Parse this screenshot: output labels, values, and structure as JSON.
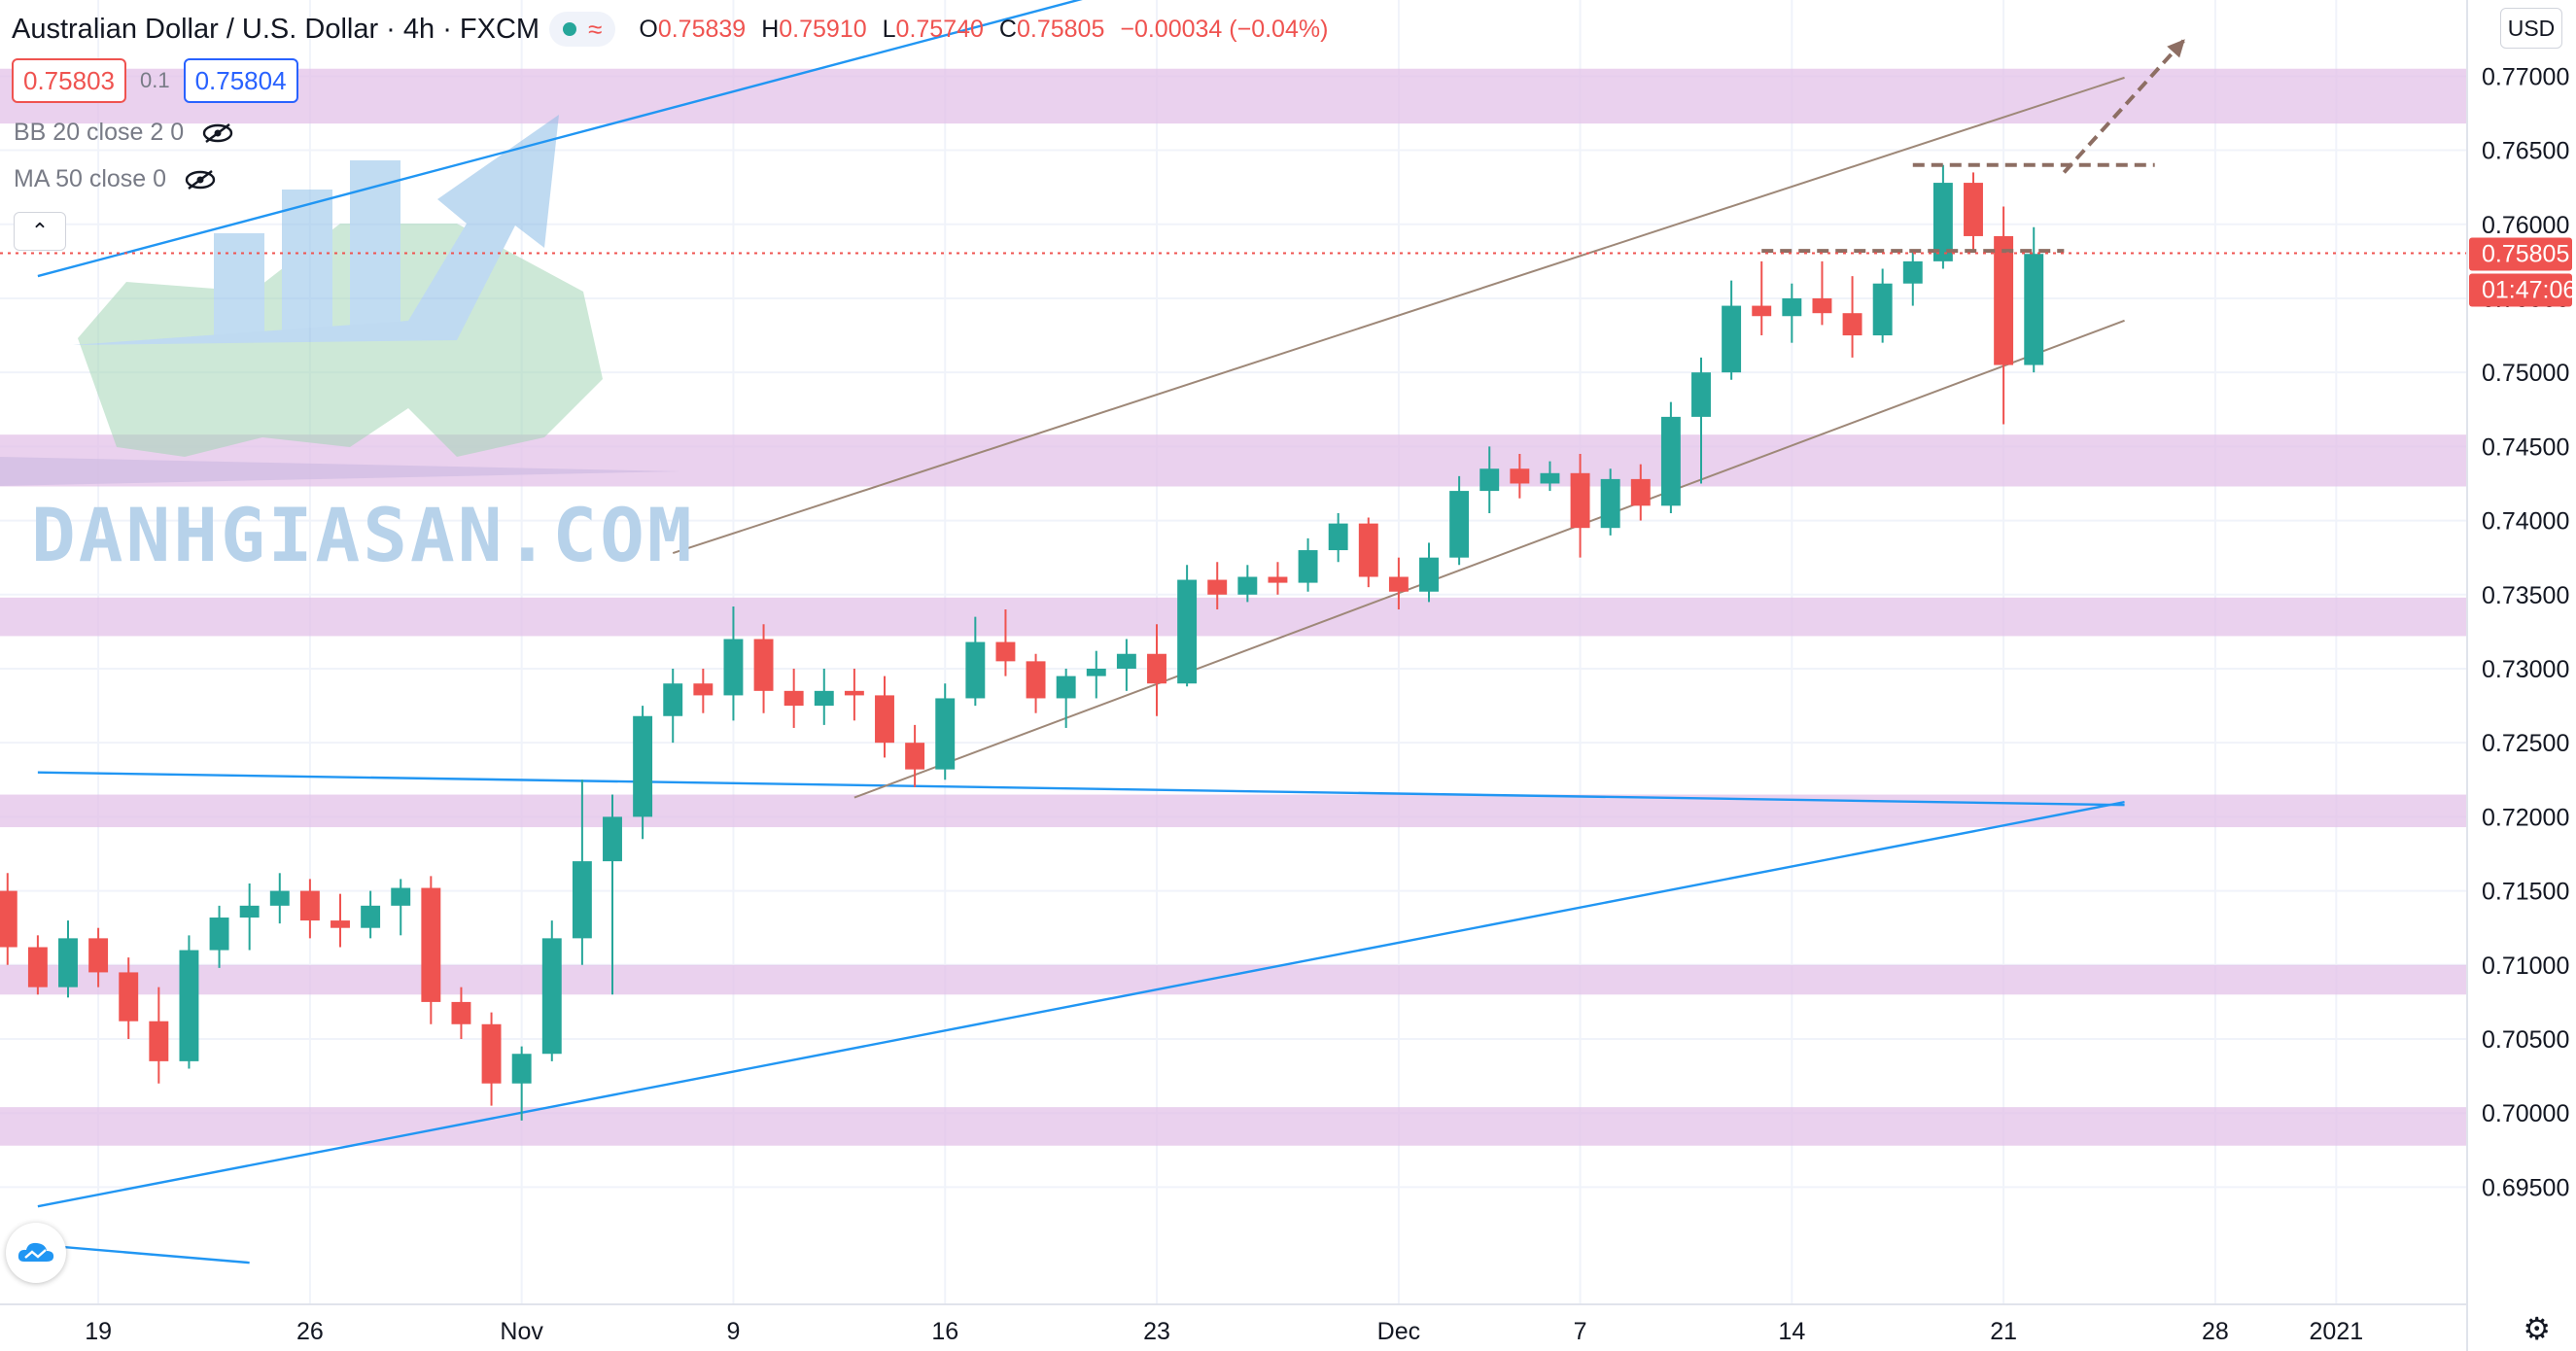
{
  "header": {
    "symbol_title": "Australian Dollar / U.S. Dollar · 4h · FXCM",
    "ohlc_o": "0.75839",
    "ohlc_h": "0.75910",
    "ohlc_l": "0.75740",
    "ohlc_c": "0.75805",
    "change": "−0.00034 (−0.04%)",
    "o_label": "O",
    "h_label": "H",
    "l_label": "L",
    "c_label": "C"
  },
  "trade": {
    "sell_price": "0.75803",
    "spread": "0.1",
    "buy_price": "0.75804"
  },
  "indicators": [
    {
      "label": "BB 20 close 2 0"
    },
    {
      "label": "MA 50 close 0"
    }
  ],
  "currency": "USD",
  "watermark": {
    "text": "DANHGIASAN.COM"
  },
  "colors": {
    "up": "#26a69a",
    "down": "#ef5350",
    "zone": "#e1bee7",
    "trend": "#2196f3",
    "channel": "#9e8878",
    "dashed": "#8d6e63"
  },
  "chart_data": {
    "type": "candlestick",
    "title": "",
    "ylim": [
      0.6905,
      0.7735
    ],
    "y_ticks": [
      "0.77000",
      "0.76500",
      "0.76000",
      "0.75500",
      "0.75000",
      "0.74500",
      "0.74000",
      "0.73500",
      "0.73000",
      "0.72500",
      "0.72000",
      "0.71500",
      "0.71000",
      "0.70500",
      "0.70000",
      "0.69500"
    ],
    "x_ticks": [
      {
        "label": "19",
        "date": "2020-10-19"
      },
      {
        "label": "26",
        "date": "2020-10-26"
      },
      {
        "label": "Nov",
        "date": "2020-11-02"
      },
      {
        "label": "9",
        "date": "2020-11-09"
      },
      {
        "label": "16",
        "date": "2020-11-16"
      },
      {
        "label": "23",
        "date": "2020-11-23"
      },
      {
        "label": "Dec",
        "date": "2020-12-01"
      },
      {
        "label": "7",
        "date": "2020-12-07"
      },
      {
        "label": "14",
        "date": "2020-12-14"
      },
      {
        "label": "21",
        "date": "2020-12-21"
      },
      {
        "label": "28",
        "date": "2020-12-28"
      },
      {
        "label": "2021",
        "date": "2021-01-01"
      }
    ],
    "last_price": "0.75805",
    "countdown": "01:47:06",
    "support_resistance_zones": [
      [
        0.7668,
        0.7705
      ],
      [
        0.7423,
        0.7458
      ],
      [
        0.7322,
        0.7348
      ],
      [
        0.7193,
        0.7215
      ],
      [
        0.708,
        0.71
      ],
      [
        0.6978,
        0.7004
      ]
    ],
    "trendlines": [
      {
        "from": [
          "2020-10-17",
          0.7565
        ],
        "to": [
          "2020-11-29",
          0.7798
        ]
      },
      {
        "from": [
          "2020-10-17",
          0.723
        ],
        "to": [
          "2020-12-25",
          0.7208
        ]
      },
      {
        "from": [
          "2020-10-17",
          0.6937
        ],
        "to": [
          "2020-12-25",
          0.721
        ]
      },
      {
        "from": [
          "2020-10-17",
          0.6911
        ],
        "to": [
          "2020-10-24",
          0.6899
        ]
      },
      {
        "from": [
          "2020-11-07",
          0.7378
        ],
        "to": [
          "2020-12-25",
          0.7699
        ]
      },
      {
        "from": [
          "2020-11-13",
          0.7213
        ],
        "to": [
          "2020-12-25",
          0.7535
        ]
      }
    ],
    "dashed_levels": [
      {
        "from": "2020-12-18",
        "to": "2020-12-26",
        "value": 0.764
      },
      {
        "from": "2020-12-13",
        "to": "2020-12-23",
        "value": 0.7582
      }
    ],
    "projection_arrow": {
      "from": [
        "2020-12-23",
        0.7635
      ],
      "to": [
        "2020-12-27",
        0.7725
      ]
    },
    "candles": [
      [
        "2020-10-16",
        0.715,
        0.7162,
        0.71,
        0.7112
      ],
      [
        "2020-10-17",
        0.7112,
        0.712,
        0.708,
        0.7085
      ],
      [
        "2020-10-18",
        0.7085,
        0.713,
        0.7078,
        0.7118
      ],
      [
        "2020-10-19",
        0.7118,
        0.7125,
        0.7085,
        0.7095
      ],
      [
        "2020-10-20",
        0.7095,
        0.7105,
        0.705,
        0.7062
      ],
      [
        "2020-10-21",
        0.7062,
        0.7085,
        0.702,
        0.7035
      ],
      [
        "2020-10-22",
        0.7035,
        0.712,
        0.703,
        0.711
      ],
      [
        "2020-10-23",
        0.711,
        0.714,
        0.7098,
        0.7132
      ],
      [
        "2020-10-24",
        0.7132,
        0.7155,
        0.711,
        0.714
      ],
      [
        "2020-10-25",
        0.714,
        0.7162,
        0.7128,
        0.715
      ],
      [
        "2020-10-26",
        0.715,
        0.7158,
        0.7118,
        0.713
      ],
      [
        "2020-10-27",
        0.713,
        0.7148,
        0.7112,
        0.7125
      ],
      [
        "2020-10-28",
        0.7125,
        0.715,
        0.7118,
        0.714
      ],
      [
        "2020-10-29",
        0.714,
        0.7158,
        0.712,
        0.7152
      ],
      [
        "2020-10-30",
        0.7152,
        0.716,
        0.706,
        0.7075
      ],
      [
        "2020-10-31",
        0.7075,
        0.7085,
        0.705,
        0.706
      ],
      [
        "2020-11-01",
        0.706,
        0.7068,
        0.7005,
        0.702
      ],
      [
        "2020-11-02",
        0.702,
        0.7045,
        0.6995,
        0.704
      ],
      [
        "2020-11-03",
        0.704,
        0.713,
        0.7035,
        0.7118
      ],
      [
        "2020-11-04",
        0.7118,
        0.7225,
        0.71,
        0.717
      ],
      [
        "2020-11-05",
        0.717,
        0.7215,
        0.708,
        0.72
      ],
      [
        "2020-11-06",
        0.72,
        0.7275,
        0.7185,
        0.7268
      ],
      [
        "2020-11-07",
        0.7268,
        0.73,
        0.725,
        0.729
      ],
      [
        "2020-11-08",
        0.729,
        0.73,
        0.727,
        0.7282
      ],
      [
        "2020-11-09",
        0.7282,
        0.7342,
        0.7265,
        0.732
      ],
      [
        "2020-11-10",
        0.732,
        0.733,
        0.727,
        0.7285
      ],
      [
        "2020-11-11",
        0.7285,
        0.73,
        0.726,
        0.7275
      ],
      [
        "2020-11-12",
        0.7275,
        0.73,
        0.7262,
        0.7285
      ],
      [
        "2020-11-13",
        0.7285,
        0.73,
        0.7265,
        0.7282
      ],
      [
        "2020-11-14",
        0.7282,
        0.7295,
        0.724,
        0.725
      ],
      [
        "2020-11-15",
        0.725,
        0.7262,
        0.722,
        0.7232
      ],
      [
        "2020-11-16",
        0.7232,
        0.729,
        0.7225,
        0.728
      ],
      [
        "2020-11-17",
        0.728,
        0.7335,
        0.7275,
        0.7318
      ],
      [
        "2020-11-18",
        0.7318,
        0.734,
        0.7295,
        0.7305
      ],
      [
        "2020-11-19",
        0.7305,
        0.731,
        0.727,
        0.728
      ],
      [
        "2020-11-20",
        0.728,
        0.73,
        0.726,
        0.7295
      ],
      [
        "2020-11-21",
        0.7295,
        0.7312,
        0.728,
        0.73
      ],
      [
        "2020-11-22",
        0.73,
        0.732,
        0.7285,
        0.731
      ],
      [
        "2020-11-23",
        0.731,
        0.733,
        0.7268,
        0.729
      ],
      [
        "2020-11-24",
        0.729,
        0.737,
        0.7288,
        0.736
      ],
      [
        "2020-11-25",
        0.736,
        0.7372,
        0.734,
        0.735
      ],
      [
        "2020-11-26",
        0.735,
        0.737,
        0.7345,
        0.7362
      ],
      [
        "2020-11-27",
        0.7362,
        0.7372,
        0.735,
        0.7358
      ],
      [
        "2020-11-28",
        0.7358,
        0.7388,
        0.7352,
        0.738
      ],
      [
        "2020-11-29",
        0.738,
        0.7405,
        0.7372,
        0.7398
      ],
      [
        "2020-11-30",
        0.7398,
        0.7402,
        0.7355,
        0.7362
      ],
      [
        "2020-12-01",
        0.7362,
        0.7375,
        0.734,
        0.7352
      ],
      [
        "2020-12-02",
        0.7352,
        0.7385,
        0.7345,
        0.7375
      ],
      [
        "2020-12-03",
        0.7375,
        0.743,
        0.737,
        0.742
      ],
      [
        "2020-12-04",
        0.742,
        0.745,
        0.7405,
        0.7435
      ],
      [
        "2020-12-05",
        0.7435,
        0.7445,
        0.7415,
        0.7425
      ],
      [
        "2020-12-06",
        0.7425,
        0.744,
        0.742,
        0.7432
      ],
      [
        "2020-12-07",
        0.7432,
        0.7445,
        0.7375,
        0.7395
      ],
      [
        "2020-12-08",
        0.7395,
        0.7435,
        0.739,
        0.7428
      ],
      [
        "2020-12-09",
        0.7428,
        0.7438,
        0.74,
        0.741
      ],
      [
        "2020-12-10",
        0.741,
        0.748,
        0.7405,
        0.747
      ],
      [
        "2020-12-11",
        0.747,
        0.751,
        0.7425,
        0.75
      ],
      [
        "2020-12-12",
        0.75,
        0.7562,
        0.7495,
        0.7545
      ],
      [
        "2020-12-13",
        0.7545,
        0.7575,
        0.7525,
        0.7538
      ],
      [
        "2020-12-14",
        0.7538,
        0.756,
        0.752,
        0.755
      ],
      [
        "2020-12-15",
        0.755,
        0.7575,
        0.7532,
        0.754
      ],
      [
        "2020-12-16",
        0.754,
        0.7565,
        0.751,
        0.7525
      ],
      [
        "2020-12-17",
        0.7525,
        0.757,
        0.752,
        0.756
      ],
      [
        "2020-12-18",
        0.756,
        0.7582,
        0.7545,
        0.7575
      ],
      [
        "2020-12-19",
        0.7575,
        0.764,
        0.757,
        0.7628
      ],
      [
        "2020-12-20",
        0.7628,
        0.7635,
        0.7582,
        0.7592
      ],
      [
        "2020-12-21",
        0.7592,
        0.7612,
        0.7465,
        0.7505
      ],
      [
        "2020-12-22",
        0.7505,
        0.7598,
        0.75,
        0.758
      ]
    ]
  }
}
